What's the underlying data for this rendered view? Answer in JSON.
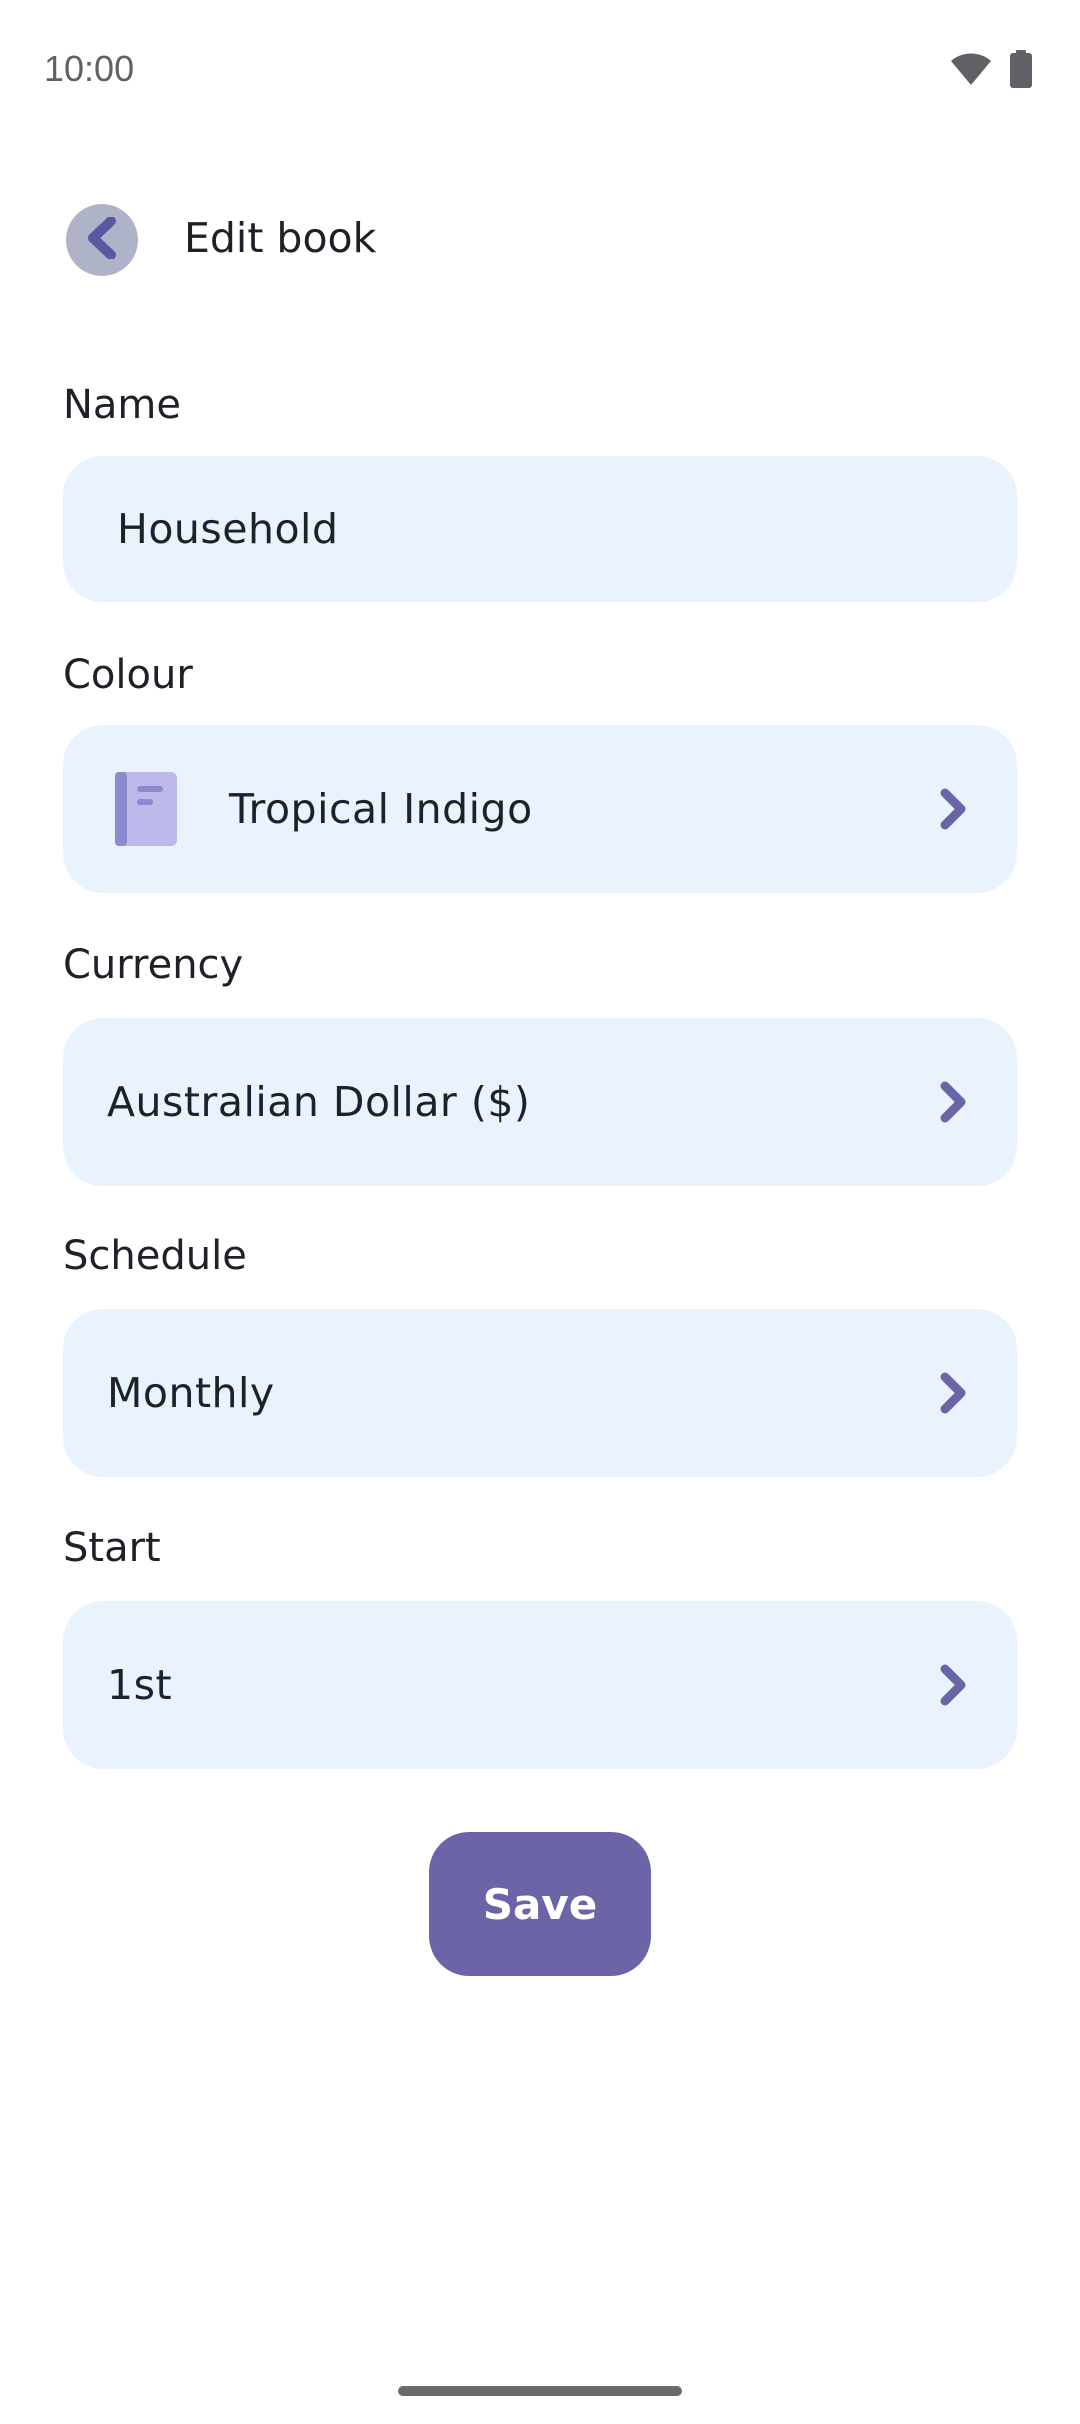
{
  "status_bar": {
    "time": "10:00",
    "icons": [
      "wifi-icon",
      "battery-icon"
    ]
  },
  "header": {
    "back_icon": "chevron-left-icon",
    "title": "Edit book"
  },
  "form": {
    "name": {
      "label": "Name",
      "value": "Household"
    },
    "colour": {
      "label": "Colour",
      "value": "Tropical Indigo",
      "swatch_color": "#bdb9ea",
      "icon": "book-icon"
    },
    "currency": {
      "label": "Currency",
      "value": "Australian Dollar ($)"
    },
    "schedule": {
      "label": "Schedule",
      "value": "Monthly"
    },
    "start": {
      "label": "Start",
      "value": "1st"
    }
  },
  "actions": {
    "save_label": "Save"
  },
  "colors": {
    "accent": "#6b65a8",
    "field_background": "#e8f3fe",
    "back_button_background": "#aeb3c8"
  }
}
